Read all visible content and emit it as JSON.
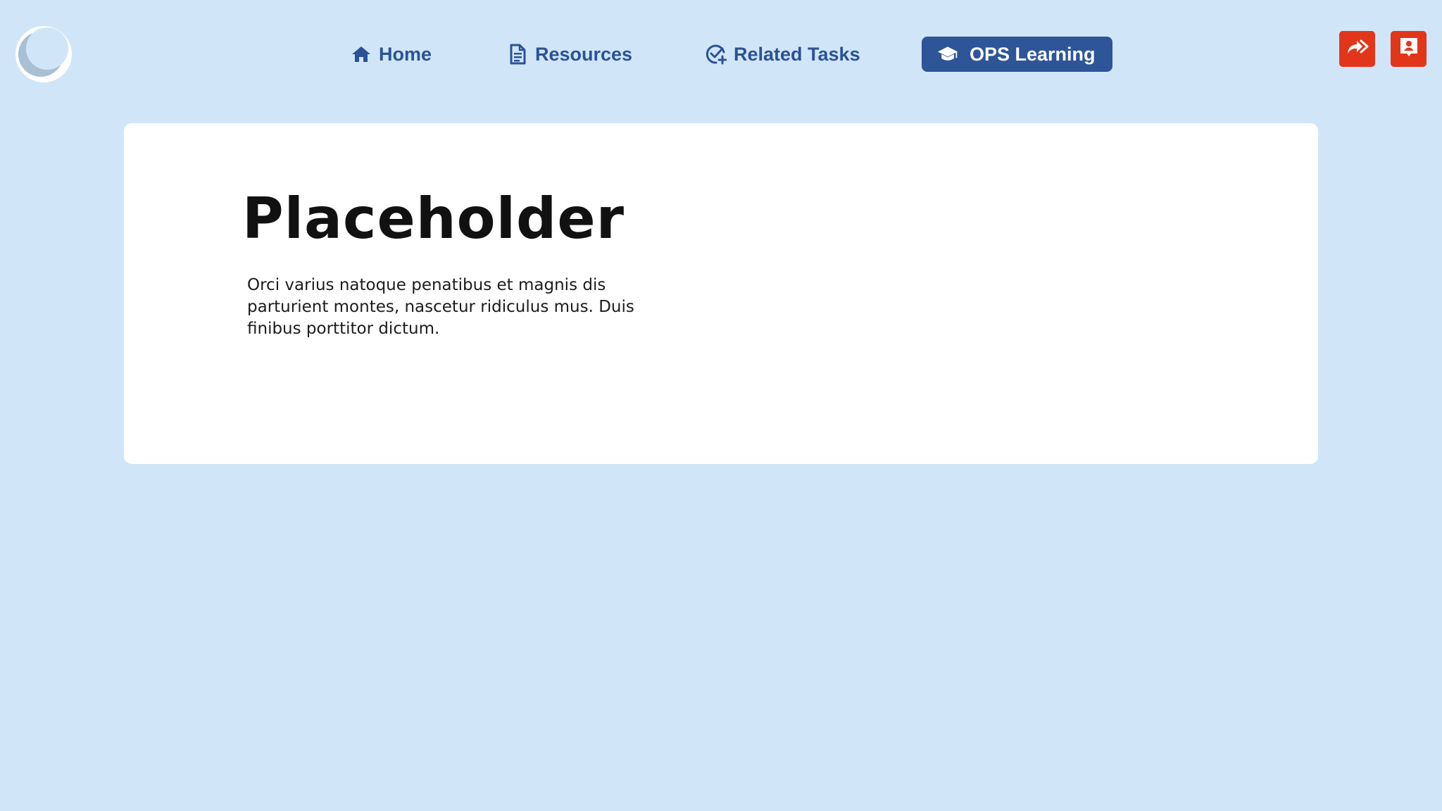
{
  "nav": {
    "items": [
      {
        "label": "Home",
        "icon": "home-icon",
        "active": false
      },
      {
        "label": "Resources",
        "icon": "document-icon",
        "active": false
      },
      {
        "label": "Related Tasks",
        "icon": "check-add-icon",
        "active": false
      },
      {
        "label": "OPS Learning",
        "icon": "graduation-cap-icon",
        "active": true
      }
    ],
    "actions": [
      {
        "icon": "forward-arrows-icon"
      },
      {
        "icon": "contact-card-icon"
      }
    ]
  },
  "main": {
    "title": "Placeholder",
    "body": "Orci varius natoque penatibus et magnis dis parturient montes, nascetur ridiculus mus. Duis finibus porttitor dictum."
  },
  "colors": {
    "background": "#d0e6f8",
    "accent": "#2d5597",
    "action": "#e2361a",
    "card": "#ffffff"
  }
}
